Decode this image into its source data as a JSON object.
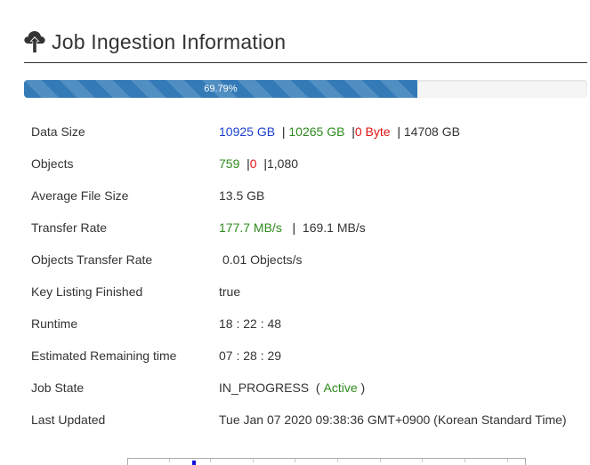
{
  "header": {
    "title": "Job Ingestion Information",
    "icon": "cloud-upload-icon"
  },
  "progress": {
    "percent": 69.79,
    "label": "69.79%"
  },
  "rows": {
    "data_size": {
      "label": "Data Size",
      "transferred": "10925 GB",
      "succeeded": "10265 GB",
      "failed": "0 Byte",
      "total": "14708 GB"
    },
    "objects": {
      "label": "Objects",
      "succeeded": "759",
      "failed": "0",
      "total": "1,080"
    },
    "average_file_size": {
      "label": "Average File Size",
      "value": "13.5 GB"
    },
    "transfer_rate": {
      "label": "Transfer Rate",
      "current": "177.7 MB/s",
      "average": "169.1 MB/s"
    },
    "objects_transfer_rate": {
      "label": "Objects Transfer Rate",
      "value": "0.01 Objects/s"
    },
    "key_listing_finished": {
      "label": "Key Listing Finished",
      "value": "true"
    },
    "runtime": {
      "label": "Runtime",
      "value": "18 : 22 : 48"
    },
    "estimated_remaining": {
      "label": "Estimated Remaining time",
      "value": "07 : 28 : 29"
    },
    "job_state": {
      "label": "Job State",
      "state": "IN_PROGRESS",
      "status": "Active"
    },
    "last_updated": {
      "label": "Last Updated",
      "value": "Tue Jan 07 2020 09:38:36 GMT+0900 (Korean Standard Time)"
    }
  },
  "colors": {
    "blue": "#1a3fcf",
    "green": "#2e8b1e",
    "red": "#e01515",
    "progress": "#337ab7"
  }
}
